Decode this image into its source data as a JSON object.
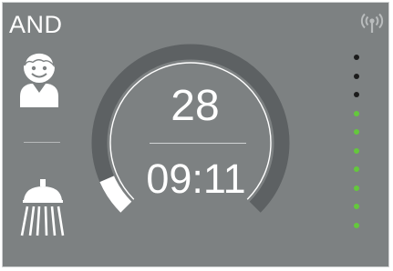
{
  "header": {
    "mode_label": "AND",
    "signal_icon": "antenna-signal-icon"
  },
  "sidebar": {
    "user_icon": "child-face-icon",
    "shower_icon": "shower-head-icon"
  },
  "dial": {
    "value": "28",
    "time": "09:11",
    "level_fraction": 0.08,
    "track_color": "#5d6163",
    "fill_color": "#ffffff"
  },
  "level_indicator": {
    "dots": [
      {
        "state": "off",
        "color": "#1c1c1c"
      },
      {
        "state": "off",
        "color": "#1c1c1c"
      },
      {
        "state": "off",
        "color": "#1c1c1c"
      },
      {
        "state": "on",
        "color": "#64c83c"
      },
      {
        "state": "on",
        "color": "#64c83c"
      },
      {
        "state": "on",
        "color": "#64c83c"
      },
      {
        "state": "on",
        "color": "#64c83c"
      },
      {
        "state": "on",
        "color": "#64c83c"
      },
      {
        "state": "on",
        "color": "#64c83c"
      },
      {
        "state": "on",
        "color": "#64c83c"
      }
    ]
  }
}
